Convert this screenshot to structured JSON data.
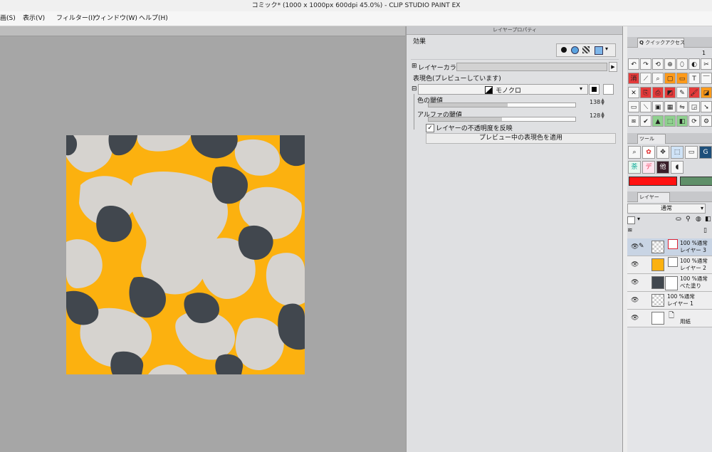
{
  "window": {
    "title": "コミック* (1000 x 1000px 600dpi 45.0%)  - CLIP STUDIO PAINT EX"
  },
  "menu": {
    "items": [
      "画(S)",
      "表示(V)",
      "フィルター(I)",
      "ウィンドウ(W)",
      "ヘルプ(H)"
    ]
  },
  "artwork": {
    "colors": {
      "orange": "#fcb10f",
      "light_gray": "#d6d3cf",
      "dark_slate": "#41474e"
    }
  },
  "layer_property": {
    "panel_title": "レイヤープロパティ",
    "effect_label": "効果",
    "layer_color_label": "レイヤーカラー",
    "expression_color_label": "表現色(プレビューしています)",
    "mode_value": "モノクロ",
    "color_threshold": {
      "label": "色の閾値",
      "value": "138",
      "fraction": 0.54
    },
    "alpha_threshold": {
      "label": "アルファの閾値",
      "value": "128",
      "fraction": 0.5
    },
    "reflect_opacity_label": "レイヤーの不透明度を反映",
    "apply_button": "プレビュー中の表現色を適用"
  },
  "quick_access": {
    "tab_label": "クイックアクセス",
    "set_number": "1",
    "icons": [
      "undo-icon",
      "redo-icon",
      "transform-icon",
      "rotate-icon",
      "bucket-icon",
      "navigate-icon",
      "cut-icon",
      "erase-icon",
      "wand-icon",
      "zoom-icon",
      "select-icon",
      "rect-icon",
      "text-icon",
      "ruler-icon",
      "clear-icon",
      "copy-icon",
      "paste-icon",
      "fill-icon",
      "pen-icon",
      "brush-icon",
      "eraser-icon",
      "window-icon",
      "slash-icon",
      "frame-icon",
      "grid-icon",
      "flip-icon",
      "scale-icon",
      "arrow-icon",
      "layer-icon",
      "check-icon",
      "triangle-icon",
      "paint-icon",
      "tone-icon",
      "refresh-icon",
      "settings-icon"
    ]
  },
  "tool_panel": {
    "tab_label": "ツール",
    "icons": [
      "zoom-tool-icon",
      "color-tool-icon",
      "move-tool-icon",
      "select-tool-icon",
      "frame-tool-icon",
      "decoration-tool-icon",
      "text-tool-icon",
      "eyedropper-tool-icon",
      "other-tool-icon",
      "blend-tool-icon"
    ],
    "main_color": "#ff1111",
    "sub_color": "#5f8f69"
  },
  "layer_panel": {
    "tab_label": "レイヤー",
    "blend_mode": "通常",
    "layers": [
      {
        "line1": "100 %通常",
        "line2": "レイヤー 3",
        "selected": true
      },
      {
        "line1": "100 %通常",
        "line2": "レイヤー 2",
        "selected": false
      },
      {
        "line1": "100 %通常",
        "line2": "べた塗り",
        "selected": false
      },
      {
        "line1": "100 %通常",
        "line2": "レイヤー 1",
        "selected": false
      },
      {
        "line1": "",
        "line2": "用紙",
        "selected": false
      }
    ]
  }
}
